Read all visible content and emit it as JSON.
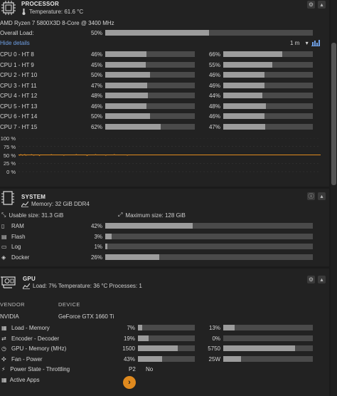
{
  "processor": {
    "title": "PROCESSOR",
    "temperature": "Temperature: 61.6 °C",
    "model": "AMD Ryzen 7 5800X3D 8-Core @ 3400 MHz",
    "overall_label": "Overall Load:",
    "overall_pct": "50%",
    "overall_value": 0.5,
    "hide_details": "Hide details",
    "interval": "1 m",
    "interval_caret": "▾",
    "left_cores": [
      {
        "label": "CPU 0 - HT 8",
        "pct": "46%",
        "v": 0.46
      },
      {
        "label": "CPU 1 - HT 9",
        "pct": "45%",
        "v": 0.45
      },
      {
        "label": "CPU 2 - HT 10",
        "pct": "50%",
        "v": 0.5
      },
      {
        "label": "CPU 3 - HT 11",
        "pct": "47%",
        "v": 0.47
      },
      {
        "label": "CPU 4 - HT 12",
        "pct": "48%",
        "v": 0.48
      },
      {
        "label": "CPU 5 - HT 13",
        "pct": "46%",
        "v": 0.46
      },
      {
        "label": "CPU 6 - HT 14",
        "pct": "50%",
        "v": 0.5
      },
      {
        "label": "CPU 7 - HT 15",
        "pct": "62%",
        "v": 0.62
      }
    ],
    "right_cores": [
      {
        "pct": "66%",
        "v": 0.66
      },
      {
        "pct": "55%",
        "v": 0.55
      },
      {
        "pct": "46%",
        "v": 0.46
      },
      {
        "pct": "46%",
        "v": 0.46
      },
      {
        "pct": "44%",
        "v": 0.44
      },
      {
        "pct": "48%",
        "v": 0.48
      },
      {
        "pct": "46%",
        "v": 0.46
      },
      {
        "pct": "47%",
        "v": 0.47
      }
    ]
  },
  "chart_data": {
    "type": "line",
    "title": "",
    "xlabel": "",
    "ylabel": "",
    "y_ticks": [
      "100 %",
      "75 %",
      "50 %",
      "25 %",
      "0 %"
    ],
    "ylim": [
      0,
      100
    ],
    "grid": true,
    "series": [
      {
        "values": [
          50,
          50,
          49,
          50,
          51,
          50,
          50,
          49,
          50,
          50,
          50,
          51,
          50,
          49,
          50,
          50,
          50,
          50,
          50,
          50,
          50,
          50,
          50,
          51,
          50,
          50,
          50,
          49,
          50,
          50,
          50,
          50,
          50,
          50,
          50,
          50,
          50,
          48,
          50,
          50,
          50,
          50,
          50,
          50,
          50,
          50,
          50,
          50,
          50,
          50,
          50,
          50,
          50,
          50,
          50,
          50,
          50,
          50,
          51,
          50,
          50,
          50,
          50,
          50,
          50,
          50,
          50,
          50,
          50,
          50,
          50,
          50,
          50,
          50,
          50,
          50,
          50,
          50,
          50,
          50,
          49,
          50,
          50,
          50,
          50,
          50,
          50,
          50,
          50,
          50,
          50,
          50,
          50,
          50,
          50,
          50,
          50,
          50,
          50,
          50,
          50,
          50,
          51,
          50,
          50,
          50,
          50,
          50,
          50,
          50,
          50,
          50,
          50,
          50,
          50,
          50,
          50,
          50,
          50,
          50,
          50,
          48,
          50,
          50,
          50,
          50,
          50,
          50,
          50,
          50,
          50,
          50,
          50,
          50,
          50,
          50,
          51,
          50,
          50,
          50,
          50,
          50,
          50,
          50,
          50,
          50,
          50,
          50,
          50,
          50,
          50,
          50,
          50,
          50,
          49,
          50,
          50,
          50,
          50,
          50,
          50,
          50,
          50,
          50,
          50,
          50,
          50,
          50,
          50,
          51,
          50,
          50,
          50,
          50,
          50,
          50,
          50,
          50,
          50,
          50,
          50,
          50,
          50,
          50,
          50,
          50,
          50,
          50,
          50,
          50,
          50,
          50,
          49,
          50,
          50,
          50,
          50,
          50,
          50,
          50,
          50,
          50,
          50,
          50,
          50,
          50,
          50,
          50,
          50,
          50,
          50,
          50,
          50,
          50,
          50,
          50,
          50,
          50,
          50,
          50,
          50,
          50,
          50,
          50,
          50,
          50,
          50,
          50,
          50,
          50,
          50,
          50,
          50,
          50,
          50,
          50,
          50,
          50,
          50,
          50,
          50,
          50,
          50,
          50,
          50,
          50,
          50,
          50,
          50,
          50,
          50,
          50,
          50,
          50,
          50,
          50,
          50,
          50,
          50,
          50,
          50,
          50,
          50,
          50,
          50,
          50,
          50,
          50,
          50,
          50,
          50,
          50,
          50,
          50,
          50,
          50,
          50,
          50,
          50,
          50,
          50,
          50,
          50,
          50,
          50,
          50,
          50,
          50,
          50,
          50,
          50,
          50,
          50,
          50,
          50,
          50,
          50,
          50,
          50,
          50,
          50,
          50,
          50,
          50,
          50,
          50,
          50,
          50,
          50,
          50,
          50,
          50,
          50,
          50,
          50,
          50,
          50,
          50,
          50,
          50,
          50,
          50,
          50,
          50,
          50,
          50,
          50,
          50,
          50,
          50,
          50,
          50,
          50,
          50,
          50,
          50,
          50,
          50,
          50,
          50,
          50,
          50,
          50,
          50,
          50,
          50,
          50,
          50,
          50,
          50,
          50,
          50,
          50,
          50,
          50,
          50,
          50,
          50,
          50,
          50,
          50,
          50,
          50,
          50,
          50,
          50,
          50,
          50,
          50,
          50,
          50,
          50,
          50,
          50,
          50,
          50,
          50,
          50,
          50,
          50,
          50,
          50,
          50,
          50,
          50,
          50,
          50,
          50,
          50,
          50,
          50,
          50,
          50,
          50,
          50,
          50,
          50,
          50,
          50,
          50,
          50,
          50,
          50,
          50,
          50,
          50,
          50,
          50,
          50,
          50,
          50,
          50,
          50,
          50,
          50,
          50,
          50,
          50,
          50,
          50,
          50,
          50,
          50,
          50,
          50,
          50,
          50,
          50,
          50,
          50,
          50,
          50,
          50,
          50,
          50,
          50,
          50,
          50,
          50,
          50,
          50,
          50,
          50,
          50,
          50,
          50,
          50,
          50,
          50,
          50,
          50,
          50,
          50,
          50,
          50,
          50,
          50,
          50,
          50,
          50,
          50,
          50,
          50,
          50,
          50,
          50,
          50,
          50,
          50,
          50,
          50,
          50,
          50,
          50,
          50,
          50,
          50,
          50,
          50,
          50,
          50,
          50,
          50,
          50,
          50,
          50,
          50,
          50,
          50,
          50,
          50,
          50,
          50,
          50,
          50,
          50,
          50,
          50,
          50,
          50,
          50,
          50,
          50,
          50,
          50,
          50,
          50,
          50,
          50,
          50,
          50,
          50,
          50,
          50,
          50,
          50,
          50,
          50,
          50,
          50,
          50,
          50,
          50,
          50,
          50,
          50,
          50,
          50,
          50,
          50,
          50,
          50,
          50,
          50
        ]
      }
    ],
    "series_color": "#e08a1e"
  },
  "system": {
    "title": "SYSTEM",
    "memory": "Memory: 32 GiB DDR4",
    "usable": "Usable size: 31.3 GiB",
    "maximum": "Maximum size: 128 GiB",
    "rows": [
      {
        "label": "RAM",
        "pct": "42%",
        "v": 0.42,
        "icon": "ram-icon"
      },
      {
        "label": "Flash",
        "pct": "3%",
        "v": 0.03,
        "icon": "flash-icon"
      },
      {
        "label": "Log",
        "pct": "1%",
        "v": 0.01,
        "icon": "log-icon"
      },
      {
        "label": "Docker",
        "pct": "26%",
        "v": 0.26,
        "icon": "docker-icon"
      }
    ]
  },
  "gpu": {
    "title": "GPU",
    "summary": "Load: 7% Temperature: 36 °C Processes: 1",
    "vendor_hdr": "VENDOR",
    "device_hdr": "DEVICE",
    "vendor": "NVIDIA",
    "device": "GeForce GTX 1660 Ti",
    "rows": [
      {
        "label": "Load - Memory",
        "lpct": "7%",
        "lv": 0.07,
        "rpct": "13%",
        "rv": 0.13,
        "icon": "load-icon"
      },
      {
        "label": "Encoder - Decoder",
        "lpct": "19%",
        "lv": 0.19,
        "rpct": "0%",
        "rv": 0.0,
        "icon": "encoder-icon"
      },
      {
        "label": "GPU - Memory (MHz)",
        "lpct": "1500",
        "lv": 0.7,
        "rpct": "5750",
        "rv": 0.8,
        "icon": "gpu-clock-icon"
      },
      {
        "label": "Fan - Power",
        "lpct": "43%",
        "lv": 0.43,
        "rpct": "25W",
        "rv": 0.2,
        "icon": "fan-icon"
      }
    ],
    "power_state_label": "Power State - Throttling",
    "power_state": "P2",
    "throttling": "No",
    "active_apps_label": "Active Apps",
    "play_glyph": "›"
  },
  "colors": {
    "accent": "#e08a1e",
    "link": "#6fa0e6",
    "bar_bg": "#4a4a4a",
    "bar_fill": "#9c9c9c"
  }
}
